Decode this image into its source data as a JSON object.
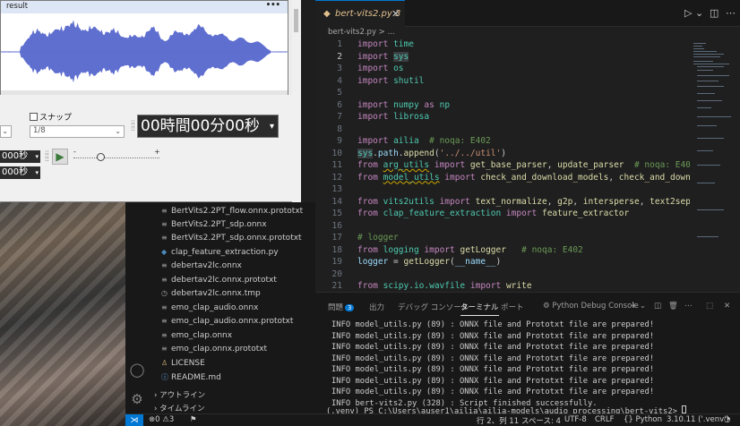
{
  "audio_app": {
    "result_title": "result",
    "more_label": "•••",
    "snap_label": "スナップ",
    "snap_value": "1/8",
    "time_display": "00時間00分00秒",
    "time_small_1": "000秒",
    "time_small_2": "000秒",
    "slider_minus": "-",
    "slider_plus": "+",
    "waveform_color": "#5f6fcf"
  },
  "editor": {
    "tab_label": "bert-vits2.py",
    "tab_badge": "3",
    "breadcrumb": "bert-vits2.py > ...",
    "code_lines": [
      "1",
      "2",
      "3",
      "4",
      "5",
      "6",
      "7",
      "8",
      "9",
      "10",
      "11",
      "12",
      "13",
      "14",
      "15",
      "16",
      "17",
      "18",
      "19",
      "20",
      "21"
    ],
    "current_line": 2
  },
  "explorer": {
    "files": [
      {
        "name": "BertVits2.2PT_flow.onnx.prototxt",
        "icon": "list-icon"
      },
      {
        "name": "BertVits2.2PT_sdp.onnx",
        "icon": "list-icon"
      },
      {
        "name": "BertVits2.2PT_sdp.onnx.prototxt",
        "icon": "list-icon"
      },
      {
        "name": "clap_feature_extraction.py",
        "icon": "python-icon"
      },
      {
        "name": "debertav2lc.onnx",
        "icon": "list-icon"
      },
      {
        "name": "debertav2lc.onnx.prototxt",
        "icon": "list-icon"
      },
      {
        "name": "debertav2lc.onnx.tmp",
        "icon": "clock-icon"
      },
      {
        "name": "emo_clap_audio.onnx",
        "icon": "list-icon"
      },
      {
        "name": "emo_clap_audio.onnx.prototxt",
        "icon": "list-icon"
      },
      {
        "name": "emo_clap.onnx",
        "icon": "list-icon"
      },
      {
        "name": "emo_clap.onnx.prototxt",
        "icon": "list-icon"
      },
      {
        "name": "LICENSE",
        "icon": "license-icon"
      },
      {
        "name": "README.md",
        "icon": "info-icon"
      }
    ],
    "outline_label": "アウトライン",
    "timeline_label": "タイムライン"
  },
  "panel": {
    "tabs": [
      {
        "label": "問題",
        "badge": "3"
      },
      {
        "label": "出力"
      },
      {
        "label": "デバッグ コンソール"
      },
      {
        "label": "ターミナル",
        "active": true
      },
      {
        "label": "ポート"
      }
    ],
    "debug_console_label": "Python Debug Console",
    "terminal_lines": [
      "INFO model_utils.py (89) : ONNX file and Prototxt file are prepared!",
      "INFO model_utils.py (89) : ONNX file and Prototxt file are prepared!",
      "INFO model_utils.py (89) : ONNX file and Prototxt file are prepared!",
      "INFO model_utils.py (89) : ONNX file and Prototxt file are prepared!",
      "INFO model_utils.py (89) : ONNX file and Prototxt file are prepared!",
      "INFO model_utils.py (89) : ONNX file and Prototxt file are prepared!",
      "INFO model_utils.py (89) : ONNX file and Prototxt file are prepared!",
      "INFO bert-vits2.py (328) : Script finished successfully.",
      "(.venv) PS C:\\Users\\auser1\\ailia\\ailia-models\\audio_processing\\bert-vits2> "
    ]
  },
  "status_bar": {
    "problems": "⊗0 ⚠3",
    "cursor": "行 2、列 11",
    "spaces": "スペース: 4",
    "encoding": "UTF-8",
    "eol": "CRLF",
    "language": "{} Python",
    "python_version": "3.10.11 ('.venv')"
  }
}
